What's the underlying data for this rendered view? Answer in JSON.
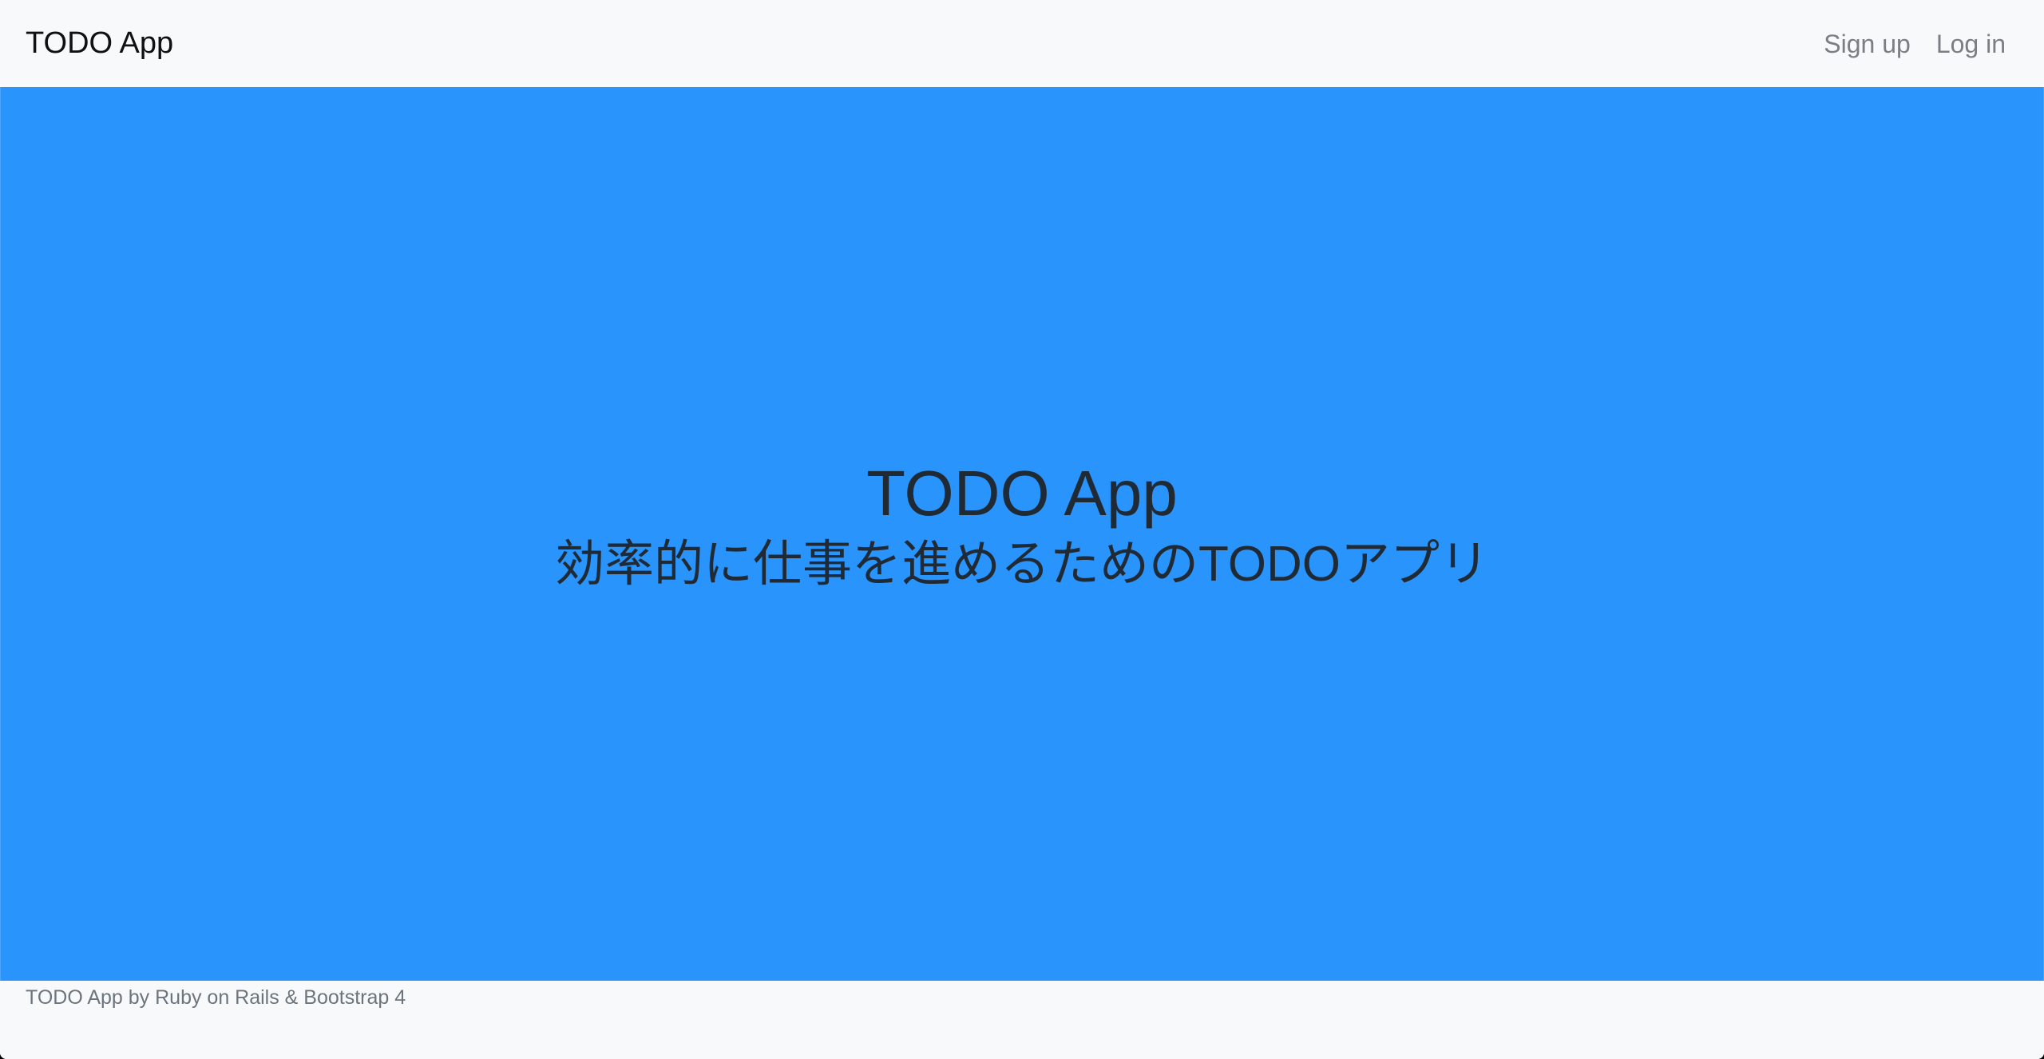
{
  "navbar": {
    "brand": "TODO App",
    "links": [
      {
        "label": "Sign up"
      },
      {
        "label": "Log in"
      }
    ]
  },
  "hero": {
    "title": "TODO App",
    "subtitle": "効率的に仕事を進めるためのTODOアプリ"
  },
  "footer": {
    "text": "TODO App by Ruby on Rails & Bootstrap 4"
  },
  "colors": {
    "hero_background": "#2894fc",
    "navbar_background": "#f8f9fa",
    "nav_link": "#7b7f83",
    "hero_text": "#1f2a35"
  }
}
